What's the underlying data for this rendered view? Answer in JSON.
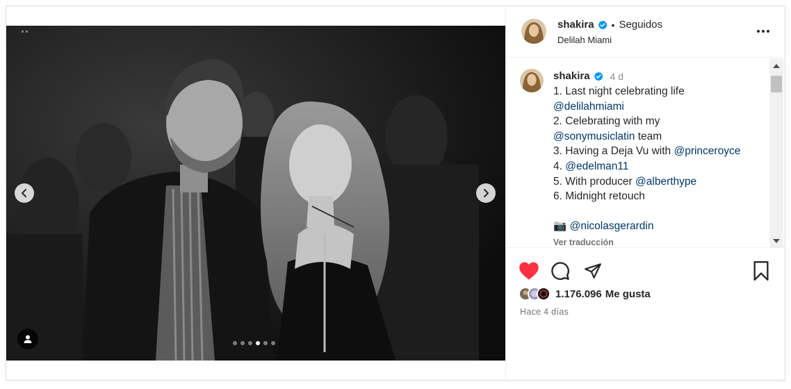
{
  "post": {
    "username": "shakira",
    "follow_state": "Seguidos",
    "separator": "•",
    "location": "Delilah Miami",
    "caption_time": "4 d",
    "caption_lines": [
      [
        {
          "t": "1. Last night celebrating life",
          "m": false
        }
      ],
      [
        {
          "t": "@delilahmiami",
          "m": true
        }
      ],
      [
        {
          "t": "2. Celebrating with my",
          "m": false
        }
      ],
      [
        {
          "t": "@sonymusiclatin",
          "m": true
        },
        {
          "t": " team",
          "m": false
        }
      ],
      [
        {
          "t": "3. Having a Deja Vu with ",
          "m": false
        },
        {
          "t": "@princeroyce",
          "m": true
        }
      ],
      [
        {
          "t": "4. ",
          "m": false
        },
        {
          "t": "@edelman11",
          "m": true
        }
      ],
      [
        {
          "t": "5. With producer ",
          "m": false
        },
        {
          "t": "@alberthype",
          "m": true
        }
      ],
      [
        {
          "t": "6. Midnight retouch",
          "m": false
        }
      ],
      [],
      [
        {
          "t": "📷 ",
          "m": false
        },
        {
          "t": "@nicolasgerardin",
          "m": true
        }
      ]
    ],
    "translate_label": "Ver traducción",
    "likes_count": "1.176.096",
    "likes_label": "Me gusta",
    "posted_time": "Hace 4 días"
  },
  "carousel": {
    "total": 6,
    "active_index": 3
  },
  "icons": {
    "verified": "verified-badge-icon",
    "more": "more-options-icon",
    "like": "heart-filled-icon",
    "comment": "comment-bubble-icon",
    "share": "paper-plane-icon",
    "save": "bookmark-icon",
    "tagged_users": "person-tag-icon",
    "prev": "chevron-left-icon",
    "next": "chevron-right-icon"
  },
  "colors": {
    "like_red": "#ff3040",
    "verified_blue": "#0095f6",
    "mention_blue": "#00376b",
    "muted_text": "#737373"
  }
}
